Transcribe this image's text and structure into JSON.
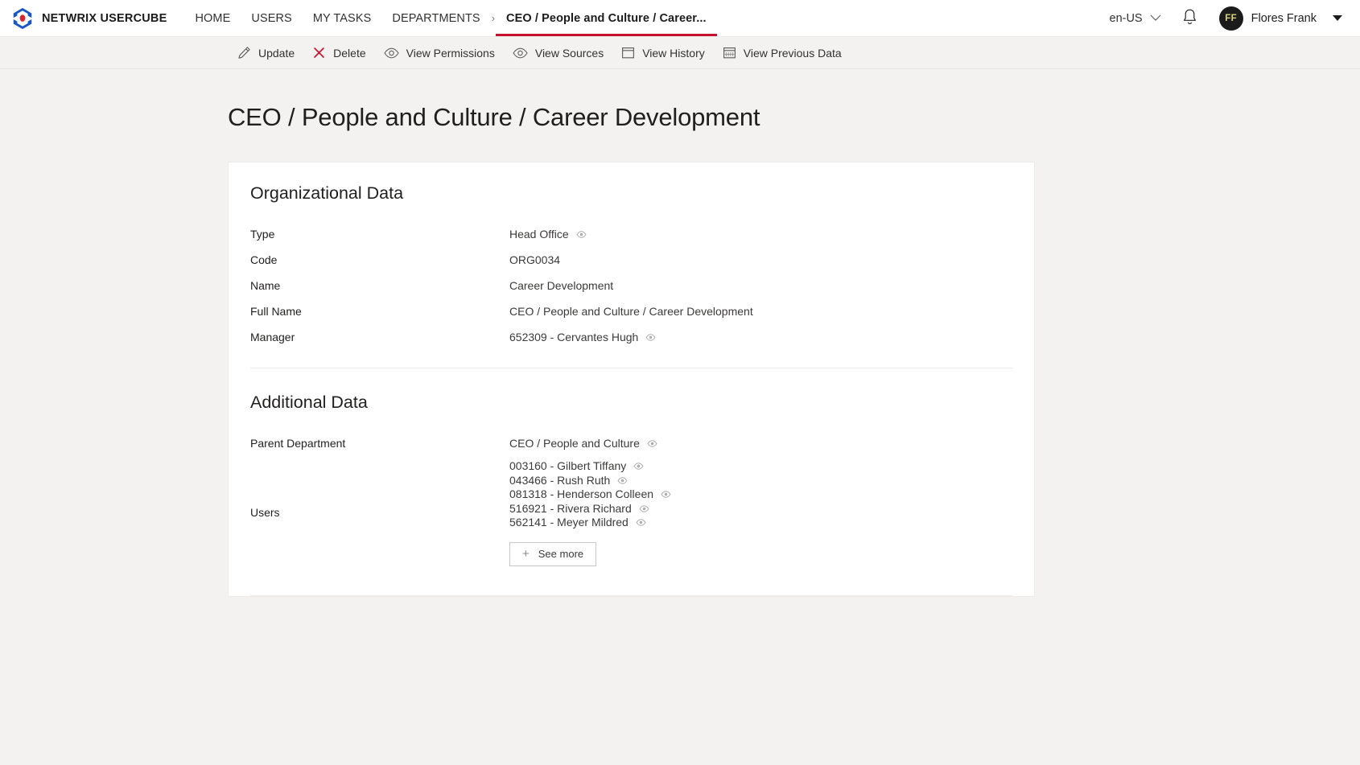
{
  "header": {
    "brand": "NETWRIX USERCUBE",
    "logo_icon": "hexagon-logo-icon",
    "nav": [
      {
        "label": "HOME",
        "current": false
      },
      {
        "label": "USERS",
        "current": false
      },
      {
        "label": "MY TASKS",
        "current": false
      },
      {
        "label": "DEPARTMENTS",
        "current": false
      }
    ],
    "breadcrumb_separator": "›",
    "breadcrumb_current": "CEO / People and Culture / Career...",
    "language": "en-US",
    "language_chevron_icon": "chevron-down-icon",
    "notifications_icon": "bell-icon",
    "avatar_initials": "FF",
    "user_name": "Flores Frank",
    "user_menu_icon": "caret-down-icon",
    "accent_color": "#c8102e"
  },
  "commandbar": {
    "items": [
      {
        "label": "Update",
        "icon": "pencil-icon"
      },
      {
        "label": "Delete",
        "icon": "close-x-icon"
      },
      {
        "label": "View Permissions",
        "icon": "eye-icon"
      },
      {
        "label": "View Sources",
        "icon": "eye-icon"
      },
      {
        "label": "View History",
        "icon": "calendar-icon"
      },
      {
        "label": "View Previous Data",
        "icon": "calendar-grid-icon"
      }
    ]
  },
  "page": {
    "title": "CEO / People and Culture / Career Development"
  },
  "sections": [
    {
      "title": "Organizational Data",
      "fields": [
        {
          "label": "Type",
          "value": "Head Office",
          "has_eye": true
        },
        {
          "label": "Code",
          "value": "ORG0034",
          "has_eye": false
        },
        {
          "label": "Name",
          "value": "Career Development",
          "has_eye": false
        },
        {
          "label": "Full Name",
          "value": "CEO / People and Culture / Career Development",
          "has_eye": false
        },
        {
          "label": "Manager",
          "value": "652309 - Cervantes Hugh",
          "has_eye": true
        }
      ]
    },
    {
      "title": "Additional Data",
      "fields": [
        {
          "label": "Parent Department",
          "value": "CEO / People and Culture",
          "has_eye": true
        }
      ],
      "users_field": {
        "label": "Users",
        "values": [
          {
            "value": "003160 - Gilbert Tiffany",
            "has_eye": true
          },
          {
            "value": "043466 - Rush Ruth",
            "has_eye": true
          },
          {
            "value": "081318 - Henderson Colleen",
            "has_eye": true
          },
          {
            "value": "516921 - Rivera Richard",
            "has_eye": true
          },
          {
            "value": "562141 - Meyer Mildred",
            "has_eye": true
          }
        ],
        "see_more_label": "See more",
        "see_more_icon": "plus-icon"
      }
    }
  ]
}
